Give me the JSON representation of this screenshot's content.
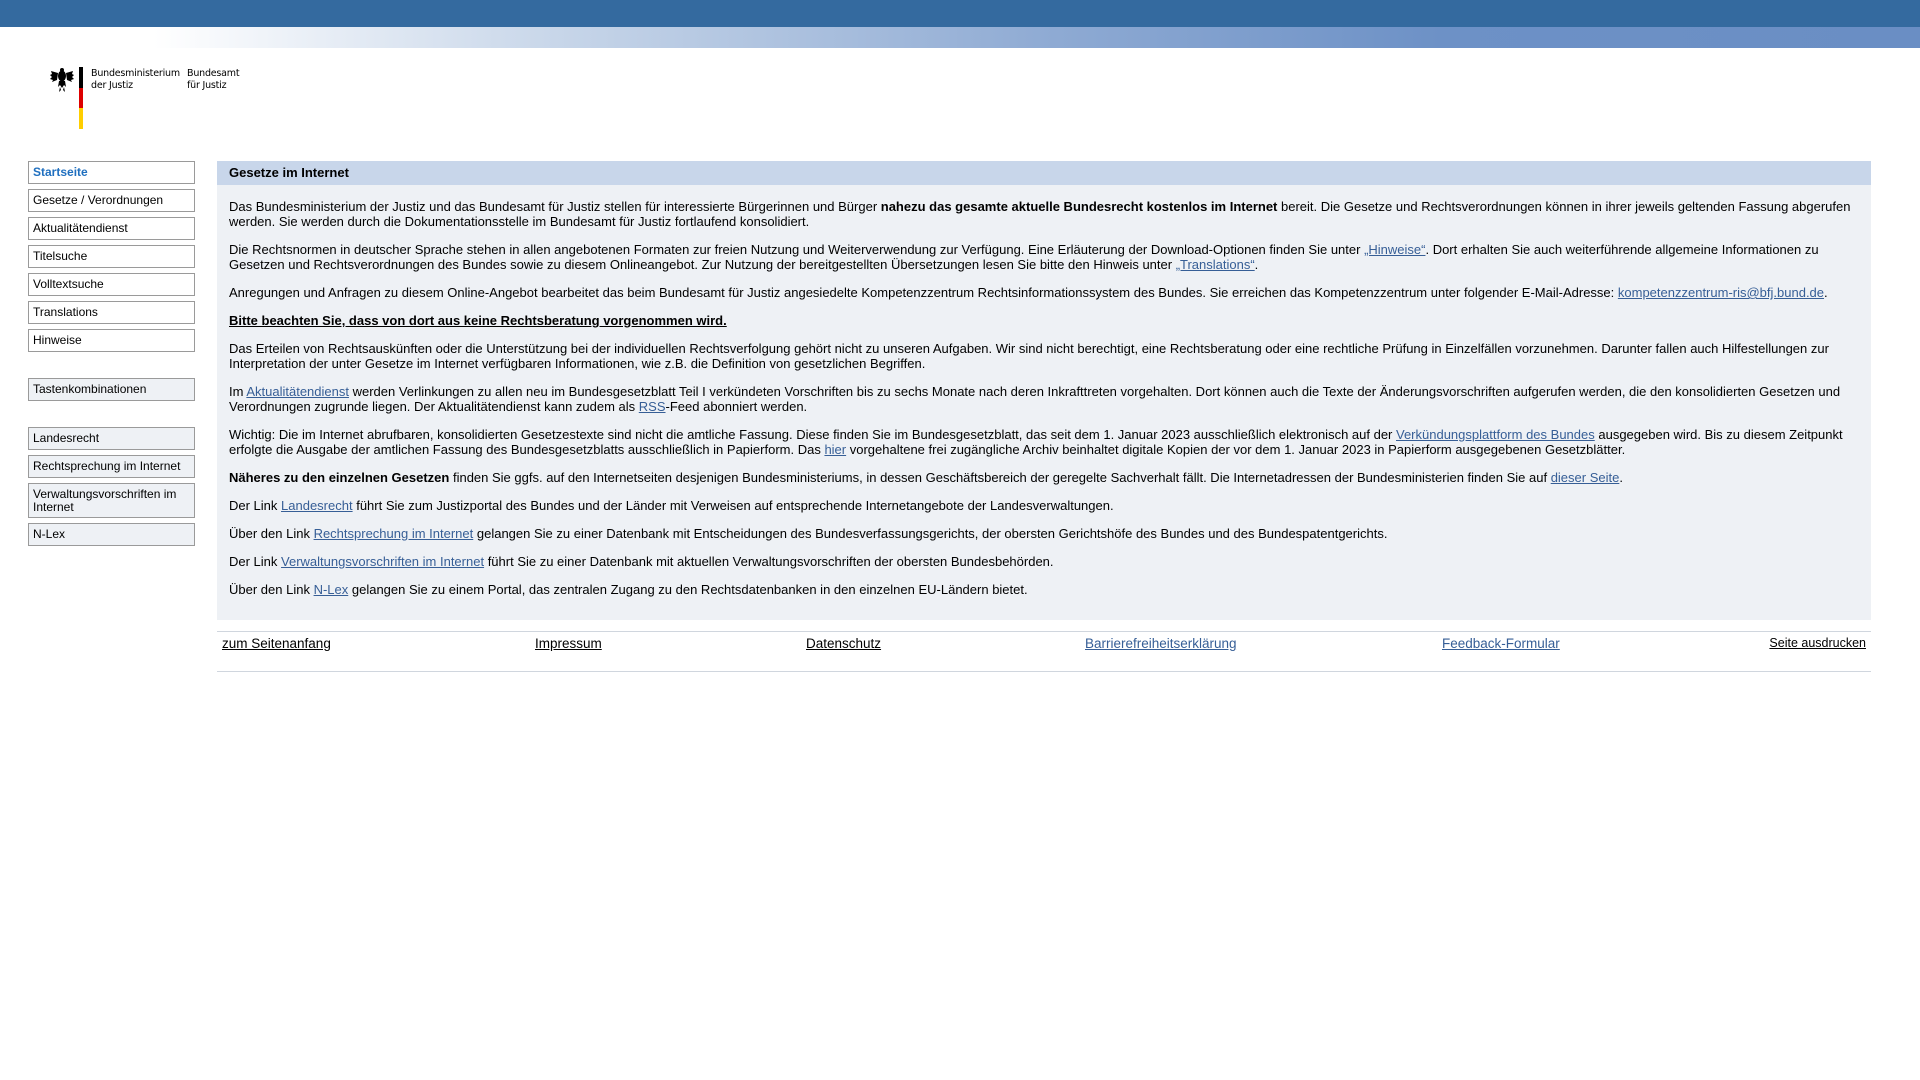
{
  "logo": {
    "ministry": "Bundesministerium\nder Justiz",
    "office": "Bundesamt\nfür Justiz"
  },
  "sidebar": {
    "group1": [
      "Startseite",
      "Gesetze / Verordnungen",
      "Aktualitätendienst",
      "Titelsuche",
      "Volltextsuche",
      "Translations",
      "Hinweise"
    ],
    "group2": [
      "Tastenkombinationen"
    ],
    "group3": [
      "Landesrecht",
      "Rechtsprechung im Internet",
      "Verwaltungsvorschriften im Internet",
      "N-Lex"
    ]
  },
  "panel": {
    "title": "Gesetze im Internet",
    "p1": {
      "a": "Das Bundesministerium der Justiz und das Bundesamt für Justiz stellen für interessierte Bürgerinnen und Bürger ",
      "b": "nahezu das gesamte aktuelle Bundesrecht kostenlos im Internet",
      "c": " bereit. Die Gesetze und Rechtsverordnungen können in ihrer jeweils geltenden Fassung abgerufen werden. Sie werden durch die Dokumentationsstelle im Bundesamt für Justiz fortlaufend konsolidiert."
    },
    "p2": {
      "a": "Die Rechtsnormen in deutscher Sprache stehen in allen angebotenen Formaten zur freien Nutzung und Weiterverwendung zur Verfügung. Eine Erläuterung der Download-Optionen finden Sie unter ",
      "link1": "„Hinweise“",
      "b": ". Dort erhalten Sie auch weiterführende allgemeine Informationen zu Gesetzen und Rechtsverordnungen des Bundes sowie zu diesem Onlineangebot. Zur Nutzung der bereitgestellten Übersetzungen lesen Sie bitte den Hinweis unter ",
      "link2": "„Translations“",
      "c": "."
    },
    "p3": {
      "a": "Anregungen und Anfragen zu diesem Online-Angebot bearbeitet das beim Bundesamt für Justiz angesiedelte Kompetenzzentrum Rechtsinformationssystem des Bundes. Sie erreichen das Kompetenzzentrum unter folgender E-Mail-Adresse: ",
      "link": "kompetenzzentrum-ris@bfj.bund.de",
      "b": "."
    },
    "notice": "Bitte beachten Sie, dass von dort aus keine Rechtsberatung vorgenommen wird.",
    "p5": "Das Erteilen von Rechtsauskünften oder die Unterstützung bei der individuellen Rechtsverfolgung gehört nicht zu unseren Aufgaben. Wir sind nicht berechtigt, eine Rechtsberatung oder eine rechtliche Prüfung in Einzelfällen vorzunehmen. Darunter fallen auch Hilfestellungen zur Interpretation der unter Gesetze im Internet verfügbaren Informationen, wie z.B. die Definition von gesetzlichen Begriffen.",
    "p6": {
      "a": "Im ",
      "link1": "Aktualitätendienst",
      "b": " werden Verlinkungen zu allen neu im Bundesgesetzblatt Teil I verkündeten Vorschriften bis zu sechs Monate nach deren Inkrafttreten vorgehalten. Dort können auch die Texte der Änderungsvorschriften aufgerufen werden, die den konsolidierten Gesetzen und Verordnungen zugrunde liegen. Der Aktualitätendienst kann zudem als ",
      "link2": "RSS",
      "c": "-Feed abonniert werden."
    },
    "p7": {
      "a": "Wichtig: Die im Internet abrufbaren, konsolidierten Gesetzestexte sind nicht die amtliche Fassung. Diese finden Sie im Bundesgesetzblatt, das seit dem 1. Januar 2023 ausschließlich elektronisch auf der ",
      "link1": "Verkündungsplattform des Bundes",
      "b": " ausgegeben wird. Bis zu diesem Zeitpunkt erfolgte die Ausgabe der amtlichen Fassung des Bundesgesetzblatts ausschließlich in Papierform. Das ",
      "link2": "hier",
      "c": " vorgehaltene frei zugängliche Archiv beinhaltet digitale Kopien der vor dem 1. Januar 2023 in Papierform ausgegebenen Gesetzblätter."
    },
    "p8": {
      "bold": "Näheres zu den einzelnen Gesetzen",
      "a": " finden Sie ggfs. auf den Internetseiten desjenigen Bundesministeriums, in dessen Geschäftsbereich der geregelte Sachverhalt fällt. Die Internetadressen der Bundesministerien finden Sie auf ",
      "link": "dieser Seite",
      "b": "."
    },
    "p9": {
      "a": "Der Link ",
      "link": "Landesrecht",
      "b": " führt Sie zum Justizportal des Bundes und der Länder mit Verweisen auf entsprechende Internetangebote der Landesverwaltungen."
    },
    "p10": {
      "a": "Über den Link ",
      "link": "Rechtsprechung im Internet",
      "b": " gelangen Sie zu einer Datenbank mit Entscheidungen des Bundesverfassungsgerichts, der obersten Gerichtshöfe des Bundes und des Bundespatentgerichts."
    },
    "p11": {
      "a": "Der Link ",
      "link": "Verwaltungsvorschriften im Internet",
      "b": " führt Sie zu einer Datenbank mit aktuellen Verwaltungsvorschriften der obersten Bundesbehörden."
    },
    "p12": {
      "a": "Über den Link ",
      "link": "N-Lex",
      "b": " gelangen Sie zu einem Portal, das zentralen Zugang zu den Rechtsdatenbanken in den einzelnen EU-Ländern bietet."
    }
  },
  "footer": {
    "top": "zum Seitenanfang",
    "impressum": "Impressum",
    "datenschutz": "Datenschutz",
    "barrierefreiheit": "Barrierefreiheitserklärung",
    "feedback": "Feedback-Formular",
    "print": "Seite ausdrucken"
  },
  "colors": {
    "topbar": "#346a9f",
    "panel_bg": "#eef1f5",
    "panel_header": "#c8d6ea",
    "link": "#365e96",
    "active_nav": "#1f6fbf"
  }
}
